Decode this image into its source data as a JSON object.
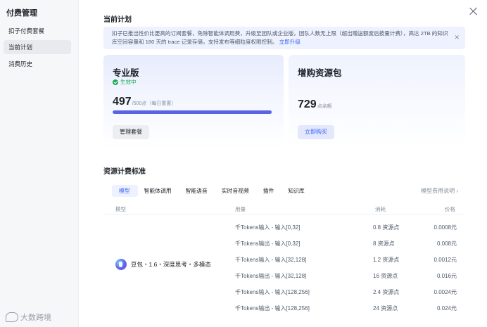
{
  "sidebar": {
    "title": "付费管理",
    "items": [
      {
        "label": "扣子付费套餐"
      },
      {
        "label": "当前计划"
      },
      {
        "label": "消费历史"
      }
    ]
  },
  "current_plan": {
    "title": "当前计划",
    "notice": {
      "text": "扣子已推出性价比更高的订阅套餐，免除智能体调用费，升级至团队或企业版，团队人数无上限（超出赠送额度后按量计费），高达 2TB 的知识库空间容量和 180 天的 trace 记录存储，支持发布等细粒度权限控制。",
      "link": "立即升级"
    },
    "pro_card": {
      "title": "专业版",
      "status": "生效中",
      "value": "497",
      "sub": "/500点（每日重置）",
      "progress_fraction": 0.994,
      "button": "管理套餐"
    },
    "pack_card": {
      "title": "增购资源包",
      "value": "729",
      "unit": "点余额",
      "button": "立即购买"
    }
  },
  "pricing": {
    "title": "资源计费标准",
    "tabs": [
      "模型",
      "智能体调用",
      "智能语音",
      "实时音视频",
      "插件",
      "知识库"
    ],
    "active_tab": 0,
    "more_link": "模型费用说明 ›",
    "headers": {
      "model": "模型",
      "usage": "用量",
      "cost": "消耗",
      "price": "价格"
    },
    "model_name": "豆包・1.6・深度思考・多模态",
    "rows": [
      {
        "usage": "千Tokens输入 - 输入[0,32]",
        "cost": "0.8 资源点",
        "price": "0.0008元"
      },
      {
        "usage": "千Tokens输出 - 输入[0,32]",
        "cost": "8 资源点",
        "price": "0.008元"
      },
      {
        "usage": "千Tokens输入 - 输入[32,128]",
        "cost": "1.2 资源点",
        "price": "0.0012元"
      },
      {
        "usage": "千Tokens输出 - 输入[32,128]",
        "cost": "16 资源点",
        "price": "0.016元"
      },
      {
        "usage": "千Tokens输入 - 输入[128,256]",
        "cost": "2.4 资源点",
        "price": "0.0024元"
      },
      {
        "usage": "千Tokens输出 - 输入[128,256]",
        "cost": "24 资源点",
        "price": "0.024元"
      }
    ]
  },
  "watermark": {
    "text": "大数跨境"
  },
  "icons": {
    "close": "close-icon",
    "check": "check-circle-icon",
    "logo": "doubao-logo-icon"
  }
}
